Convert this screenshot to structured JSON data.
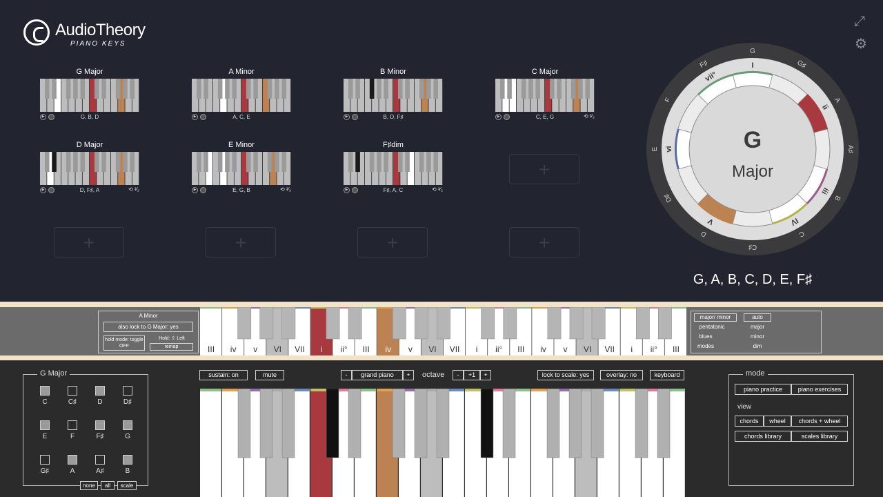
{
  "header": {
    "brand": "AudioTheory",
    "subtitle": "PIANO KEYS"
  },
  "colors": {
    "red": "#a8393f",
    "orange": "#bd8252",
    "bg": "#222530"
  },
  "chord_cards": [
    {
      "title": "G Major",
      "notes": "G, B, D",
      "inversion": "",
      "highlights": {
        "red": [
          7
        ],
        "orange": [
          11
        ],
        "white": [
          2
        ]
      },
      "black_hl": []
    },
    {
      "title": "A Minor",
      "notes": "A, C, E",
      "inversion": "",
      "highlights": {
        "red": [
          7
        ],
        "orange": [
          10
        ],
        "white": [
          4
        ]
      },
      "black_hl": []
    },
    {
      "title": "B Minor",
      "notes": "B, D, F♯",
      "inversion": "",
      "highlights": {
        "red": [
          7
        ],
        "orange": [
          11
        ],
        "white": []
      },
      "black_hl": [
        2
      ]
    },
    {
      "title": "C Major",
      "notes": "C, E, G",
      "inversion": "⟲ ³⁄₂",
      "highlights": {
        "red": [
          7
        ],
        "orange": [
          11
        ],
        "white": [
          1,
          2
        ]
      },
      "black_hl": []
    },
    {
      "title": "D Major",
      "notes": "D, F♯, A",
      "inversion": "⟲ ³⁄₂",
      "highlights": {
        "red": [
          7
        ],
        "orange": [
          11
        ],
        "white": [
          1
        ]
      },
      "black_hl": [
        1
      ]
    },
    {
      "title": "E Minor",
      "notes": "E, G, B",
      "inversion": "⟲ ³⁄₂",
      "highlights": {
        "red": [
          7
        ],
        "orange": [
          11
        ],
        "white": [
          2,
          4
        ]
      },
      "black_hl": []
    },
    {
      "title": "F♯dim",
      "notes": "F♯, A, C",
      "inversion": "⟲ ³⁄₂",
      "highlights": {
        "red": [
          7
        ],
        "orange": [],
        "white": [
          9
        ]
      },
      "black_hl": [
        1
      ]
    }
  ],
  "wheel": {
    "root": "G",
    "quality": "Major",
    "outer_notes": [
      "G",
      "G♯",
      "A",
      "A♯",
      "B",
      "C",
      "C♯",
      "D",
      "D♯",
      "E",
      "F",
      "F♯"
    ],
    "degrees": [
      {
        "label": "I",
        "note_index": 0
      },
      {
        "label": "ii",
        "note_index": 2
      },
      {
        "label": "iii",
        "note_index": 4
      },
      {
        "label": "IV",
        "note_index": 5
      },
      {
        "label": "V",
        "note_index": 7
      },
      {
        "label": "vi",
        "note_index": 9
      },
      {
        "label": "vii°",
        "note_index": 11
      }
    ],
    "scale_notes": "G, A, B, C, D, E, F♯"
  },
  "scale_strip": {
    "chord_name": "A Minor",
    "lock_label": "also lock to G Major: yes",
    "hold_mode_label": "hold mode: toggle OFF",
    "hold_label": "Hold: ⇧ Left",
    "remap_label": "remap",
    "degree_labels": [
      "III",
      "iv",
      "v",
      "VI",
      "VII",
      "i",
      "ii°",
      "III",
      "iv",
      "v",
      "VI",
      "VII",
      "i",
      "ii°",
      "III",
      "iv",
      "v",
      "VI",
      "VII",
      "i",
      "ii°",
      "III"
    ],
    "right_buttons": {
      "major_minor": "major/ minor",
      "pentatonic": "pentatonic",
      "blues": "blues",
      "modes": "modes",
      "auto": "auto",
      "major": "major",
      "minor": "minor",
      "dim": "dim"
    }
  },
  "note_selector": {
    "title": "G Major",
    "notes": [
      {
        "label": "C",
        "on": true
      },
      {
        "label": "C♯",
        "on": false
      },
      {
        "label": "D",
        "on": true
      },
      {
        "label": "D♯",
        "on": false
      },
      {
        "label": "E",
        "on": true
      },
      {
        "label": "F",
        "on": false
      },
      {
        "label": "F♯",
        "on": true
      },
      {
        "label": "G",
        "on": true
      },
      {
        "label": "G♯",
        "on": false
      },
      {
        "label": "A",
        "on": true
      },
      {
        "label": "A♯",
        "on": false
      },
      {
        "label": "B",
        "on": true
      }
    ],
    "none_label": "none",
    "all_label": "all",
    "scale_label": "scale"
  },
  "controls": {
    "sustain": "sustain: on",
    "mute": "mute",
    "minus": "-",
    "instrument": "grand piano",
    "plus": "+",
    "octave_label": "octave",
    "octave_minus": "-",
    "octave_value": "+1",
    "octave_plus": "+",
    "lock_to_scale": "lock to scale: yes",
    "overlay": "overlay: no",
    "keyboard": "keyboard"
  },
  "mode_panel": {
    "mode_title": "mode",
    "piano_practice": "piano practice",
    "piano_exercises": "piano exercises",
    "view_title": "view",
    "chords": "chords",
    "wheel": "wheel",
    "chords_wheel": "chords + wheel",
    "chords_library": "chords library",
    "scales_library": "scales library"
  },
  "main_keyboard": {
    "red_white": [
      5
    ],
    "orange_white": [
      8
    ],
    "gray_white": [
      3,
      10,
      17
    ],
    "dark_black": [
      3,
      8
    ],
    "white_count": 22
  }
}
